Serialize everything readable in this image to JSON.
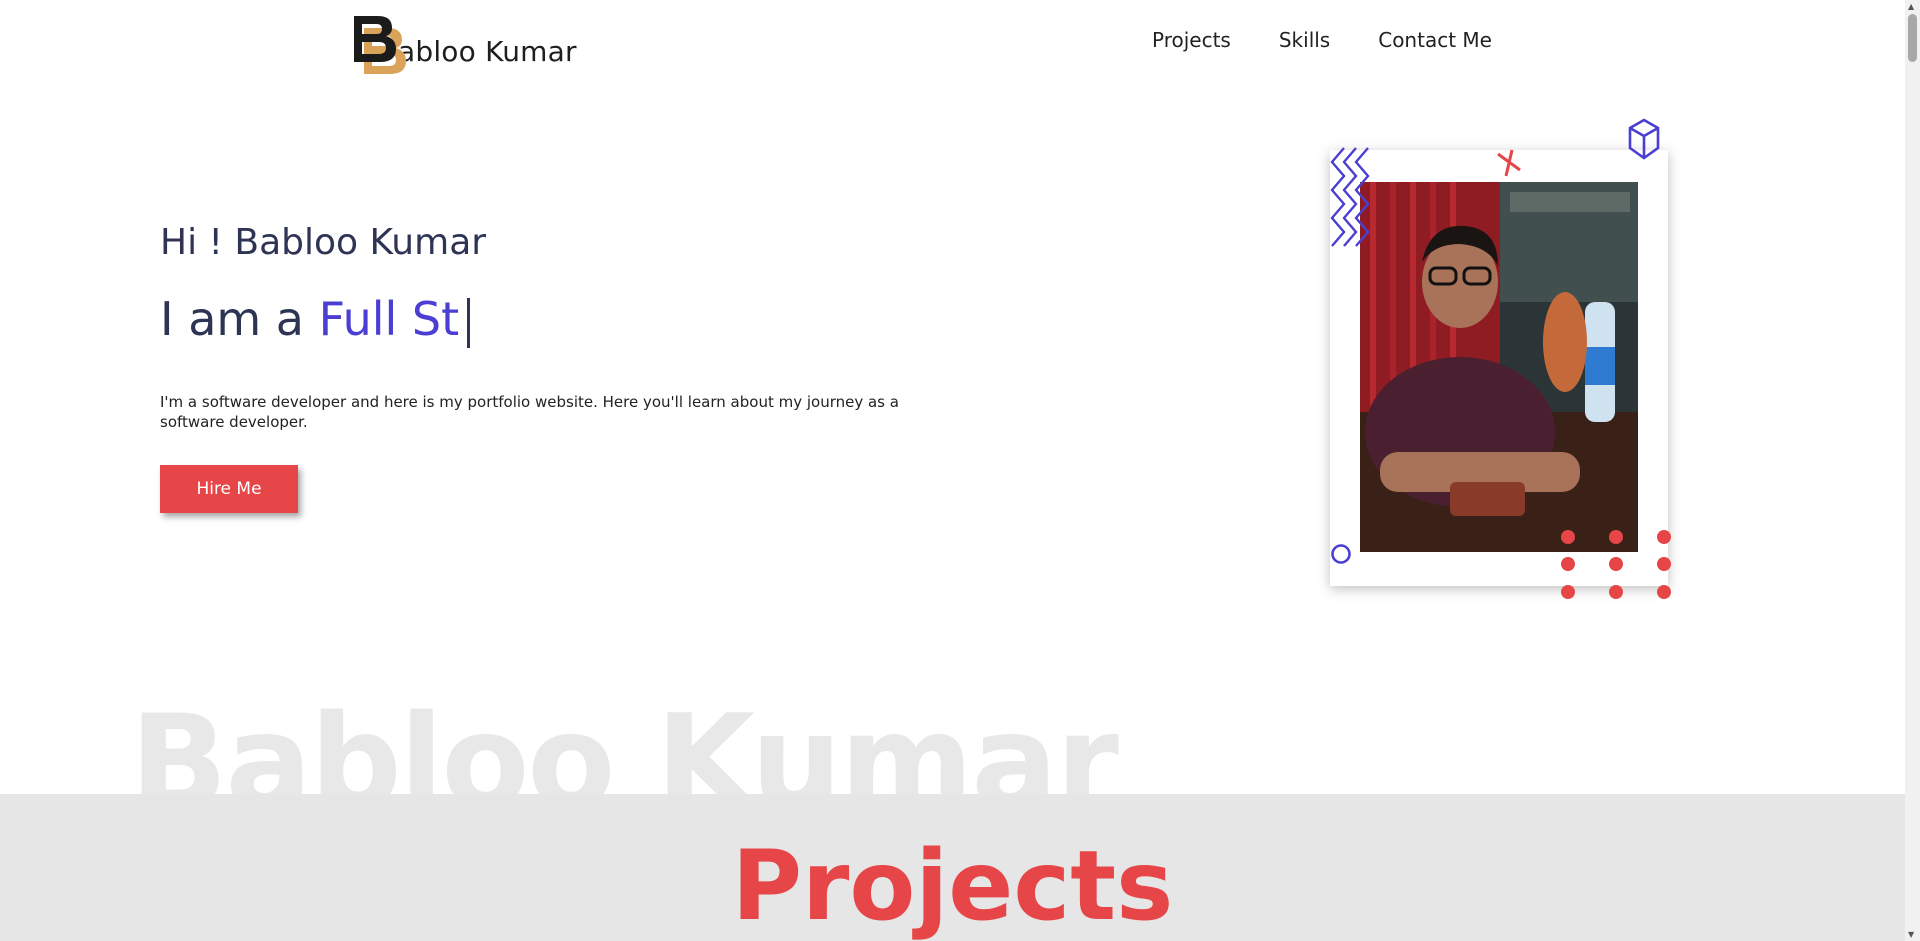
{
  "header": {
    "logo_text": "abloo Kumar",
    "nav": [
      {
        "label": "Projects"
      },
      {
        "label": "Skills"
      },
      {
        "label": "Contact Me"
      }
    ]
  },
  "hero": {
    "greeting": "Hi ! Babloo Kumar",
    "role_prefix": "I am a ",
    "role_typed": "Full St",
    "description": "I'm a software developer and here is my portfolio website. Here you'll learn about my journey as a software developer.",
    "hire_button": "Hire Me"
  },
  "watermark": "Babloo Kumar",
  "projects_section": {
    "title": "Projects"
  },
  "colors": {
    "accent_red": "#e74649",
    "accent_blue": "#4a3fd2",
    "text_dark": "#2e3454",
    "band_gray": "#e6e6e6"
  },
  "icons": [
    "logo-b-icon",
    "zigzag-icon",
    "cross-icon",
    "cube-icon",
    "circle-icon",
    "dot-grid-icon"
  ]
}
